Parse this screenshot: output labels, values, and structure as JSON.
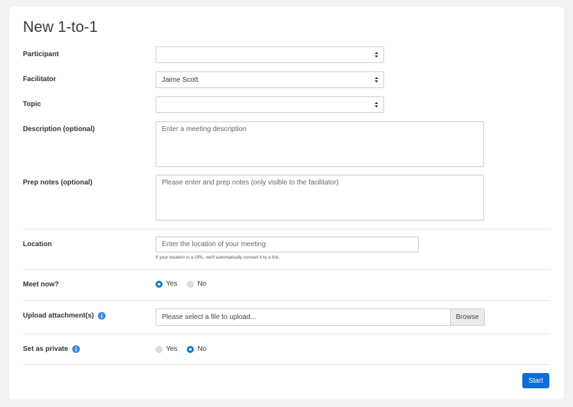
{
  "page": {
    "title": "New 1-to-1"
  },
  "form": {
    "participant": {
      "label": "Participant",
      "value": ""
    },
    "facilitator": {
      "label": "Facilitator",
      "value": "Jaime Scott"
    },
    "topic": {
      "label": "Topic",
      "value": ""
    },
    "description": {
      "label": "Description (optional)",
      "placeholder": "Enter a meeting description"
    },
    "prep_notes": {
      "label": "Prep notes (optional)",
      "placeholder": "Please enter and prep notes (only visible to the facilitator)"
    },
    "location": {
      "label": "Location",
      "placeholder": "Enter the location of your meeting",
      "hint": "If your location is a URL, we'll automatically convert it to a link."
    },
    "meet_now": {
      "label": "Meet now?",
      "yes": "Yes",
      "no": "No",
      "selected": "Yes"
    },
    "upload": {
      "label": "Upload attachment(s)",
      "placeholder": "Please select a file to upload...",
      "browse": "Browse",
      "icon": "info-icon"
    },
    "private": {
      "label": "Set as private",
      "yes": "Yes",
      "no": "No",
      "selected": "No",
      "icon": "info-icon"
    }
  },
  "actions": {
    "start": "Start"
  },
  "colors": {
    "accent": "#0a6fd6",
    "background": "#f1f2f4",
    "card": "#ffffff"
  }
}
